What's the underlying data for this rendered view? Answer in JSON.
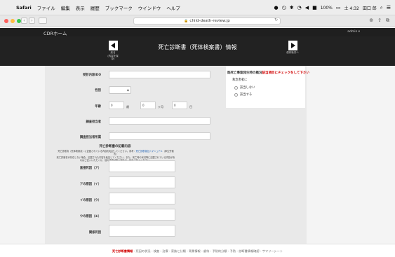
{
  "menubar": {
    "app": "Safari",
    "menus": [
      "ファイル",
      "編集",
      "表示",
      "履歴",
      "ブックマーク",
      "ウインドウ",
      "ヘルプ"
    ],
    "battery": "100%",
    "time": "土 4:32",
    "user": "田口 郎"
  },
  "browser": {
    "url": "child-death-review.jp"
  },
  "page": {
    "home_label": "CDRホーム",
    "user_menu": "admin ▾",
    "title": "死亡診断書（死体検案書）情報",
    "prev_label": "戻る",
    "prev_sublabel": "(内容を保存)",
    "next_label": "保存後次へ"
  },
  "form": {
    "fields": [
      {
        "label": "受診内容IDO"
      },
      {
        "label": "性別",
        "select": "◆"
      },
      {
        "label": "年齢",
        "year_value": "0",
        "year_unit": "歳",
        "month_value": "0",
        "month_unit": "ヶ月",
        "day_value": "0",
        "day_unit": "日"
      },
      {
        "label": "調査担当者"
      },
      {
        "label": "調査担当者所属"
      }
    ],
    "section_title": "死亡診断書の記載内容",
    "guide_line1": "死亡診断書（死体検案書）に記載されている内容を転記してください。参考：",
    "guide_link": "死亡診断書記入マニュアル",
    "guide_line2": "（厚生労働省）",
    "guide_line3": "死亡診断書が存在しない場合、記載された内容を転記してください。また、死亡時の状況等に記載されている内容があればご記入いただくか、他の書類が無い場合は、後日ご記入ください。",
    "causes": [
      {
        "label": "直接死因（ア）"
      },
      {
        "label": "アの原因（イ）"
      },
      {
        "label": "イの原因（ウ）"
      },
      {
        "label": "ウの原因（エ）"
      },
      {
        "label": "関係死因"
      }
    ]
  },
  "side_question": {
    "title_prefix": "既死亡事案発生時の概況",
    "title_red": "該当項目にチェックをして下さい",
    "subtitle": "救急患者に",
    "options": [
      "該当しない",
      "該当する"
    ]
  },
  "footer": {
    "items": [
      "死亡診断書情報",
      "死因の状況",
      "検査・治療",
      "家族と分類",
      "背景情報",
      "虐待",
      "予防的分類",
      "予防",
      "診断書情報確認",
      "サマリーシート"
    ],
    "active_index": 0
  },
  "colors": {
    "accent_red": "#d00000",
    "header_bg": "#222222",
    "panel_bg": "#e9e9e9"
  }
}
